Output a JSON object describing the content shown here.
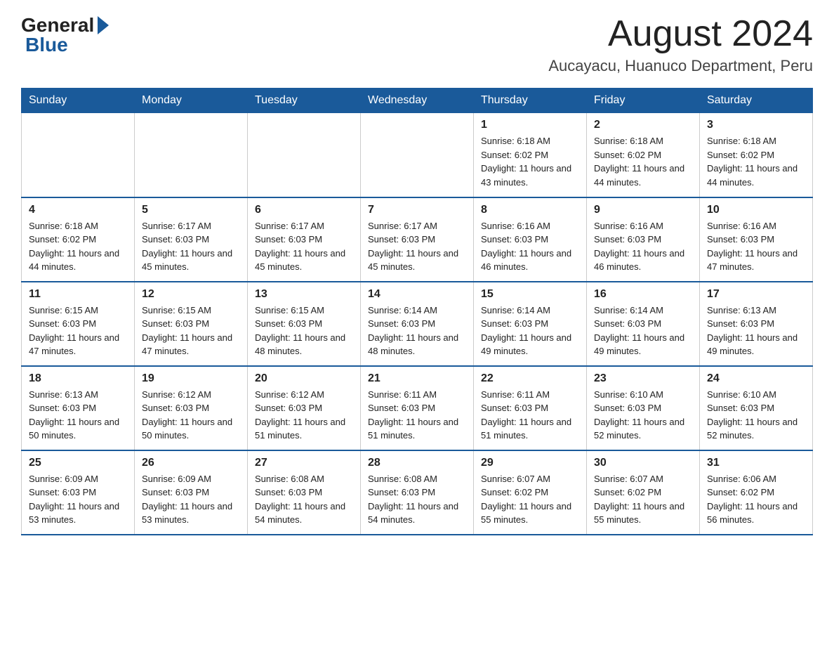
{
  "logo": {
    "text_general": "General",
    "text_blue": "Blue"
  },
  "header": {
    "month_year": "August 2024",
    "location": "Aucayacu, Huanuco Department, Peru"
  },
  "days_of_week": [
    "Sunday",
    "Monday",
    "Tuesday",
    "Wednesday",
    "Thursday",
    "Friday",
    "Saturday"
  ],
  "weeks": [
    [
      {
        "day": "",
        "info": ""
      },
      {
        "day": "",
        "info": ""
      },
      {
        "day": "",
        "info": ""
      },
      {
        "day": "",
        "info": ""
      },
      {
        "day": "1",
        "info": "Sunrise: 6:18 AM\nSunset: 6:02 PM\nDaylight: 11 hours and 43 minutes."
      },
      {
        "day": "2",
        "info": "Sunrise: 6:18 AM\nSunset: 6:02 PM\nDaylight: 11 hours and 44 minutes."
      },
      {
        "day": "3",
        "info": "Sunrise: 6:18 AM\nSunset: 6:02 PM\nDaylight: 11 hours and 44 minutes."
      }
    ],
    [
      {
        "day": "4",
        "info": "Sunrise: 6:18 AM\nSunset: 6:02 PM\nDaylight: 11 hours and 44 minutes."
      },
      {
        "day": "5",
        "info": "Sunrise: 6:17 AM\nSunset: 6:03 PM\nDaylight: 11 hours and 45 minutes."
      },
      {
        "day": "6",
        "info": "Sunrise: 6:17 AM\nSunset: 6:03 PM\nDaylight: 11 hours and 45 minutes."
      },
      {
        "day": "7",
        "info": "Sunrise: 6:17 AM\nSunset: 6:03 PM\nDaylight: 11 hours and 45 minutes."
      },
      {
        "day": "8",
        "info": "Sunrise: 6:16 AM\nSunset: 6:03 PM\nDaylight: 11 hours and 46 minutes."
      },
      {
        "day": "9",
        "info": "Sunrise: 6:16 AM\nSunset: 6:03 PM\nDaylight: 11 hours and 46 minutes."
      },
      {
        "day": "10",
        "info": "Sunrise: 6:16 AM\nSunset: 6:03 PM\nDaylight: 11 hours and 47 minutes."
      }
    ],
    [
      {
        "day": "11",
        "info": "Sunrise: 6:15 AM\nSunset: 6:03 PM\nDaylight: 11 hours and 47 minutes."
      },
      {
        "day": "12",
        "info": "Sunrise: 6:15 AM\nSunset: 6:03 PM\nDaylight: 11 hours and 47 minutes."
      },
      {
        "day": "13",
        "info": "Sunrise: 6:15 AM\nSunset: 6:03 PM\nDaylight: 11 hours and 48 minutes."
      },
      {
        "day": "14",
        "info": "Sunrise: 6:14 AM\nSunset: 6:03 PM\nDaylight: 11 hours and 48 minutes."
      },
      {
        "day": "15",
        "info": "Sunrise: 6:14 AM\nSunset: 6:03 PM\nDaylight: 11 hours and 49 minutes."
      },
      {
        "day": "16",
        "info": "Sunrise: 6:14 AM\nSunset: 6:03 PM\nDaylight: 11 hours and 49 minutes."
      },
      {
        "day": "17",
        "info": "Sunrise: 6:13 AM\nSunset: 6:03 PM\nDaylight: 11 hours and 49 minutes."
      }
    ],
    [
      {
        "day": "18",
        "info": "Sunrise: 6:13 AM\nSunset: 6:03 PM\nDaylight: 11 hours and 50 minutes."
      },
      {
        "day": "19",
        "info": "Sunrise: 6:12 AM\nSunset: 6:03 PM\nDaylight: 11 hours and 50 minutes."
      },
      {
        "day": "20",
        "info": "Sunrise: 6:12 AM\nSunset: 6:03 PM\nDaylight: 11 hours and 51 minutes."
      },
      {
        "day": "21",
        "info": "Sunrise: 6:11 AM\nSunset: 6:03 PM\nDaylight: 11 hours and 51 minutes."
      },
      {
        "day": "22",
        "info": "Sunrise: 6:11 AM\nSunset: 6:03 PM\nDaylight: 11 hours and 51 minutes."
      },
      {
        "day": "23",
        "info": "Sunrise: 6:10 AM\nSunset: 6:03 PM\nDaylight: 11 hours and 52 minutes."
      },
      {
        "day": "24",
        "info": "Sunrise: 6:10 AM\nSunset: 6:03 PM\nDaylight: 11 hours and 52 minutes."
      }
    ],
    [
      {
        "day": "25",
        "info": "Sunrise: 6:09 AM\nSunset: 6:03 PM\nDaylight: 11 hours and 53 minutes."
      },
      {
        "day": "26",
        "info": "Sunrise: 6:09 AM\nSunset: 6:03 PM\nDaylight: 11 hours and 53 minutes."
      },
      {
        "day": "27",
        "info": "Sunrise: 6:08 AM\nSunset: 6:03 PM\nDaylight: 11 hours and 54 minutes."
      },
      {
        "day": "28",
        "info": "Sunrise: 6:08 AM\nSunset: 6:03 PM\nDaylight: 11 hours and 54 minutes."
      },
      {
        "day": "29",
        "info": "Sunrise: 6:07 AM\nSunset: 6:02 PM\nDaylight: 11 hours and 55 minutes."
      },
      {
        "day": "30",
        "info": "Sunrise: 6:07 AM\nSunset: 6:02 PM\nDaylight: 11 hours and 55 minutes."
      },
      {
        "day": "31",
        "info": "Sunrise: 6:06 AM\nSunset: 6:02 PM\nDaylight: 11 hours and 56 minutes."
      }
    ]
  ]
}
